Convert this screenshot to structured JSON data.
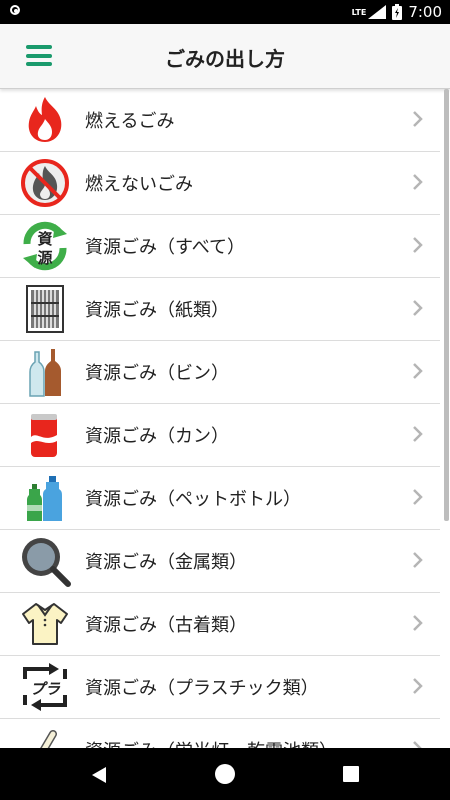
{
  "status_bar": {
    "network": "LTE",
    "time": "7:00"
  },
  "app_bar": {
    "title": "ごみの出し方",
    "menu_icon": "hamburger-menu-icon",
    "accent_color": "#1a9a6c"
  },
  "categories": [
    {
      "label": "燃えるごみ",
      "icon": "fire-icon"
    },
    {
      "label": "燃えないごみ",
      "icon": "no-fire-icon"
    },
    {
      "label": "資源ごみ（すべて）",
      "icon": "recycle-resource-icon",
      "icon_text_top": "資",
      "icon_text_bottom": "源"
    },
    {
      "label": "資源ごみ（紙類）",
      "icon": "paper-bundle-icon"
    },
    {
      "label": "資源ごみ（ビン）",
      "icon": "glass-bottle-icon"
    },
    {
      "label": "資源ごみ（カン）",
      "icon": "can-icon"
    },
    {
      "label": "資源ごみ（ペットボトル）",
      "icon": "pet-bottle-icon"
    },
    {
      "label": "資源ごみ（金属類）",
      "icon": "frying-pan-icon"
    },
    {
      "label": "資源ごみ（古着類）",
      "icon": "shirt-icon"
    },
    {
      "label": "資源ごみ（プラスチック類）",
      "icon": "plastic-mark-icon",
      "icon_text": "プラ"
    },
    {
      "label": "資源ごみ（蛍光灯・乾電池類）",
      "icon": "fluorescent-tube-icon"
    }
  ],
  "nav_bar": {
    "back_icon": "back-triangle-icon",
    "home_icon": "home-circle-icon",
    "recents_icon": "recents-square-icon"
  }
}
